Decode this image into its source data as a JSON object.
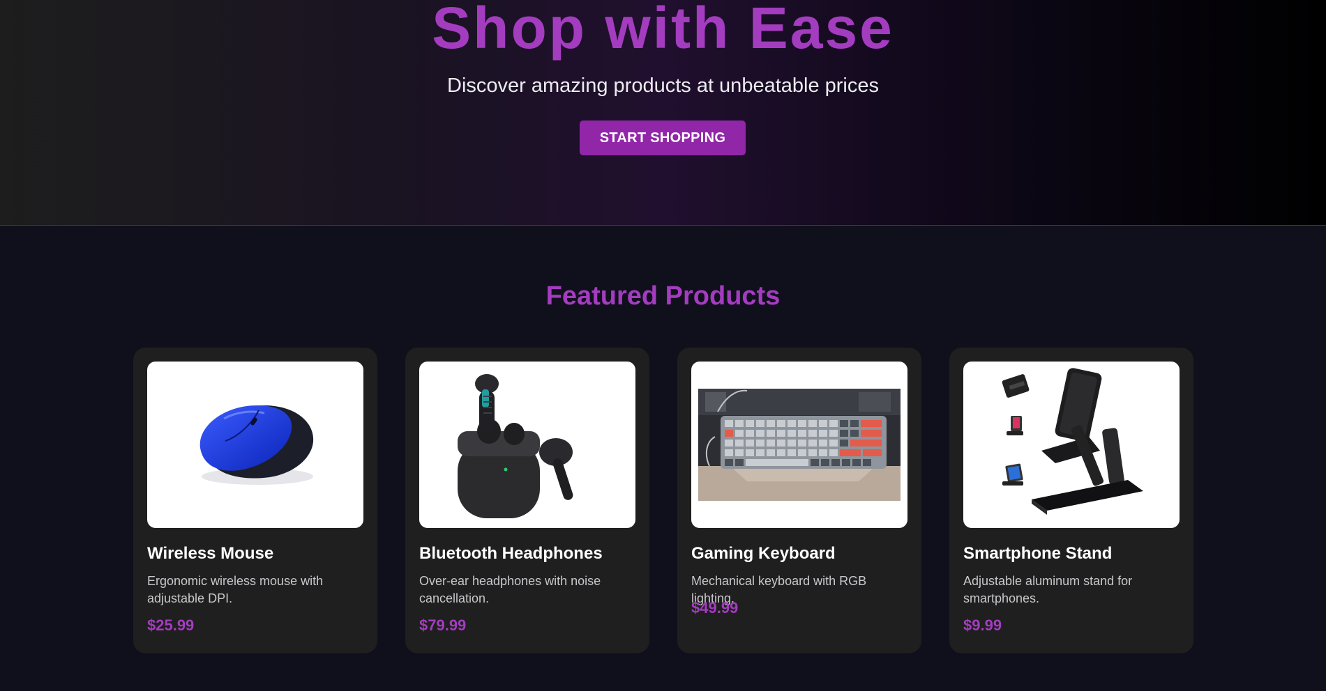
{
  "hero": {
    "title": "Shop with Ease",
    "subtitle": "Discover amazing products at unbeatable prices",
    "cta_label": "START SHOPPING"
  },
  "featured": {
    "title": "Featured Products",
    "products": [
      {
        "name": "Wireless Mouse",
        "description": "Ergonomic wireless mouse with adjustable DPI.",
        "price": "$25.99",
        "image_icon": "wireless-mouse-image"
      },
      {
        "name": "Bluetooth Headphones",
        "description": "Over-ear headphones with noise cancellation.",
        "price": "$79.99",
        "image_icon": "earbuds-image"
      },
      {
        "name": "Gaming Keyboard",
        "description": "Mechanical keyboard with RGB lighting.",
        "price": "$49.99",
        "image_icon": "keyboard-image"
      },
      {
        "name": "Smartphone Stand",
        "description": "Adjustable aluminum stand for smartphones.",
        "price": "$9.99",
        "image_icon": "phone-stand-image"
      }
    ]
  },
  "colors": {
    "accent": "#a43cc0",
    "button": "#9127a8",
    "page_bg": "#10101c",
    "card_bg": "#1f1f1f"
  }
}
